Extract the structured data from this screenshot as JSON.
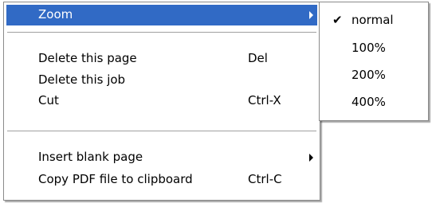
{
  "menu": {
    "items": [
      {
        "label": "Zoom",
        "accel": "",
        "submenu": true,
        "selected": true
      },
      {
        "label": "Delete this page",
        "accel": "Del"
      },
      {
        "label": "Delete this job",
        "accel": ""
      },
      {
        "label": "Cut",
        "accel": "Ctrl-X"
      },
      {
        "label": "Insert blank page",
        "accel": "",
        "submenu": true
      },
      {
        "label": "Copy PDF file to clipboard",
        "accel": "Ctrl-C"
      }
    ]
  },
  "zoom_submenu": {
    "items": [
      {
        "label": "normal",
        "checked": true
      },
      {
        "label": "100%"
      },
      {
        "label": "200%"
      },
      {
        "label": "400%"
      }
    ],
    "check_glyph": "✔"
  },
  "colors": {
    "highlight": "#316ac5",
    "separator": "#a0a0a0"
  }
}
